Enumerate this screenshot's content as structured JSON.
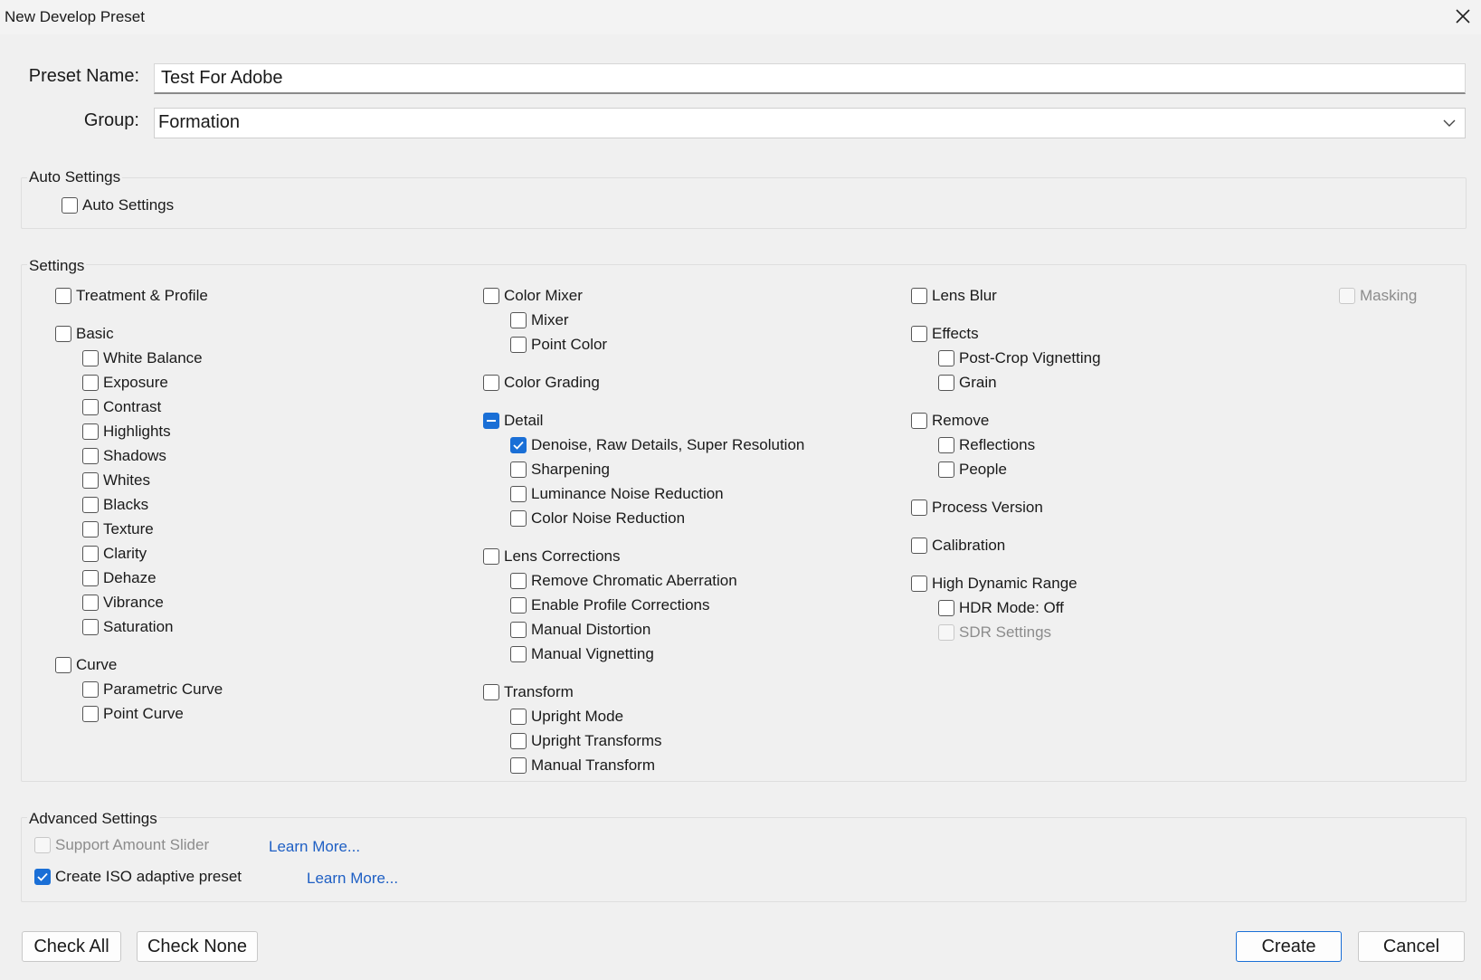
{
  "window": {
    "title": "New Develop Preset"
  },
  "preset_name": {
    "label": "Preset Name:",
    "value": "Test For Adobe"
  },
  "group": {
    "label": "Group:",
    "selected": "Formation"
  },
  "auto_settings": {
    "title": "Auto Settings",
    "items": [
      {
        "label": "Auto Settings",
        "state": "unchecked"
      }
    ]
  },
  "settings": {
    "title": "Settings",
    "items": [
      {
        "label": "Treatment & Profile",
        "state": "unchecked"
      },
      {
        "label": "Basic",
        "state": "unchecked"
      },
      {
        "label": "White Balance",
        "state": "unchecked"
      },
      {
        "label": "Exposure",
        "state": "unchecked"
      },
      {
        "label": "Contrast",
        "state": "unchecked"
      },
      {
        "label": "Highlights",
        "state": "unchecked"
      },
      {
        "label": "Shadows",
        "state": "unchecked"
      },
      {
        "label": "Whites",
        "state": "unchecked"
      },
      {
        "label": "Blacks",
        "state": "unchecked"
      },
      {
        "label": "Texture",
        "state": "unchecked"
      },
      {
        "label": "Clarity",
        "state": "unchecked"
      },
      {
        "label": "Dehaze",
        "state": "unchecked"
      },
      {
        "label": "Vibrance",
        "state": "unchecked"
      },
      {
        "label": "Saturation",
        "state": "unchecked"
      },
      {
        "label": "Curve",
        "state": "unchecked"
      },
      {
        "label": "Parametric Curve",
        "state": "unchecked"
      },
      {
        "label": "Point Curve",
        "state": "unchecked"
      },
      {
        "label": "Color Mixer",
        "state": "unchecked"
      },
      {
        "label": "Mixer",
        "state": "unchecked"
      },
      {
        "label": "Point Color",
        "state": "unchecked"
      },
      {
        "label": "Color Grading",
        "state": "unchecked"
      },
      {
        "label": "Detail",
        "state": "partial"
      },
      {
        "label": "Denoise, Raw Details, Super Resolution",
        "state": "checked"
      },
      {
        "label": "Sharpening",
        "state": "unchecked"
      },
      {
        "label": "Luminance Noise Reduction",
        "state": "unchecked"
      },
      {
        "label": "Color Noise Reduction",
        "state": "unchecked"
      },
      {
        "label": "Lens Corrections",
        "state": "unchecked"
      },
      {
        "label": "Remove Chromatic Aberration",
        "state": "unchecked"
      },
      {
        "label": "Enable Profile Corrections",
        "state": "unchecked"
      },
      {
        "label": "Manual Distortion",
        "state": "unchecked"
      },
      {
        "label": "Manual Vignetting",
        "state": "unchecked"
      },
      {
        "label": "Transform",
        "state": "unchecked"
      },
      {
        "label": "Upright Mode",
        "state": "unchecked"
      },
      {
        "label": "Upright Transforms",
        "state": "unchecked"
      },
      {
        "label": "Manual Transform",
        "state": "unchecked"
      },
      {
        "label": "Lens Blur",
        "state": "unchecked"
      },
      {
        "label": "Effects",
        "state": "unchecked"
      },
      {
        "label": "Post-Crop Vignetting",
        "state": "unchecked"
      },
      {
        "label": "Grain",
        "state": "unchecked"
      },
      {
        "label": "Remove",
        "state": "unchecked"
      },
      {
        "label": "Reflections",
        "state": "unchecked"
      },
      {
        "label": "People",
        "state": "unchecked"
      },
      {
        "label": "Process Version",
        "state": "unchecked"
      },
      {
        "label": "Calibration",
        "state": "unchecked"
      },
      {
        "label": "High Dynamic Range",
        "state": "unchecked"
      },
      {
        "label": "HDR Mode: Off",
        "state": "unchecked"
      },
      {
        "label": "SDR Settings",
        "state": "disabled"
      },
      {
        "label": "Masking",
        "state": "disabled"
      }
    ]
  },
  "advanced": {
    "title": "Advanced Settings",
    "items": [
      {
        "label": "Support Amount Slider",
        "state": "disabled"
      },
      {
        "label": "Create ISO adaptive preset",
        "state": "checked"
      }
    ],
    "learn_more_1": "Learn More...",
    "learn_more_2": "Learn More..."
  },
  "buttons": {
    "check_all": "Check All",
    "check_none": "Check None",
    "create": "Create",
    "cancel": "Cancel"
  },
  "colors": {
    "accent": "#1a6fd6",
    "link": "#1e5fc4",
    "background": "#f0f0f0"
  }
}
